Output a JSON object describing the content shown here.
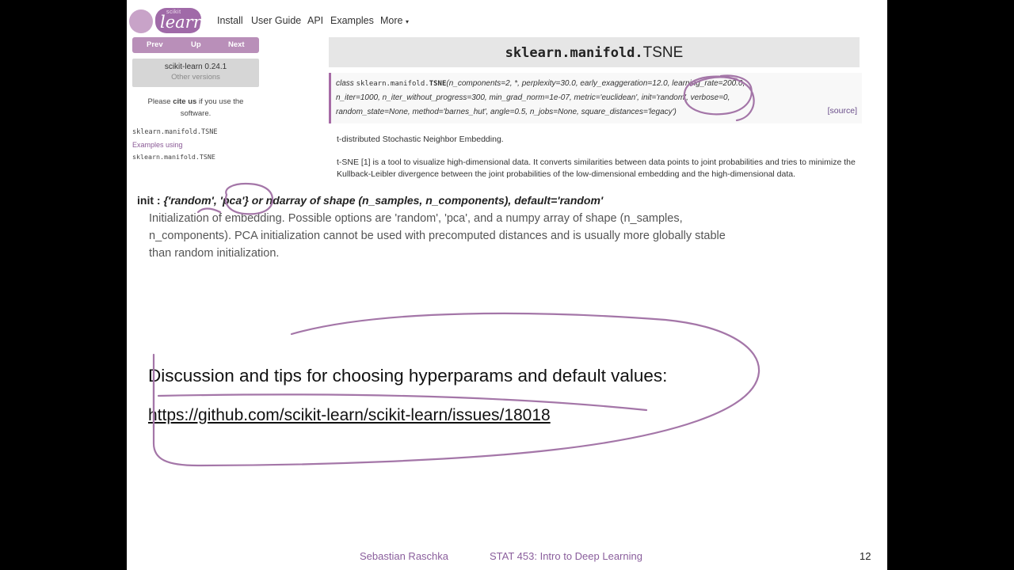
{
  "logo": {
    "small_text": "scikit",
    "main_text": "learn"
  },
  "nav": {
    "install": "Install",
    "user_guide": "User Guide",
    "api": "API",
    "examples": "Examples",
    "more": "More"
  },
  "sidebar": {
    "prev": "Prev",
    "up": "Up",
    "next": "Next",
    "version": "scikit-learn 0.24.1",
    "other_versions": "Other versions",
    "cite_prefix": "Please ",
    "cite_bold": "cite us",
    "cite_suffix": " if you use the software.",
    "link1": "sklearn.manifold.TSNE",
    "link2_prefix": "Examples using ",
    "link2_mono": "sklearn.manifold.TSNE"
  },
  "doc": {
    "title_module": "sklearn.manifold.",
    "title_class": "TSNE",
    "sig_line1_prefix": "class ",
    "sig_line1_mono": "sklearn.manifold.",
    "sig_line1_class": "TSNE",
    "sig_line1_rest": "(n_components=2, *, perplexity=30.0, early_exaggeration=12.0, learning_rate=200.0,",
    "sig_line2": "n_iter=1000, n_iter_without_progress=300, min_grad_norm=1e-07, metric='euclidean', init='random', verbose=0,",
    "sig_line3": "random_state=None, method='barnes_hut', angle=0.5, n_jobs=None, square_distances='legacy')",
    "source": "[source]",
    "desc1": "t-distributed Stochastic Neighbor Embedding.",
    "desc2": "t-SNE [1] is a tool to visualize high-dimensional data. It converts similarities between data points to joint probabilities and tries to minimize the Kullback-Leibler divergence between the joint probabilities of the low-dimensional embedding and the high-dimensional data."
  },
  "param": {
    "name": "init : ",
    "type": "{'random', 'pca'} or ndarray of shape (n_samples, n_components), default='random'",
    "desc": "Initialization of embedding. Possible options are 'random', 'pca', and a numpy array of shape (n_samples, n_components). PCA initialization cannot be used with precomputed distances and is usually more globally stable than random initialization."
  },
  "discussion": {
    "text": "Discussion and tips for choosing hyperparams and default values:",
    "link": "https://github.com/scikit-learn/scikit-learn/issues/18018"
  },
  "footer": {
    "author": "Sebastian Raschka",
    "course": "STAT 453: Intro to Deep Learning",
    "page": "12"
  },
  "colors": {
    "accent": "#a06aa8",
    "ink": "#a476a8"
  }
}
